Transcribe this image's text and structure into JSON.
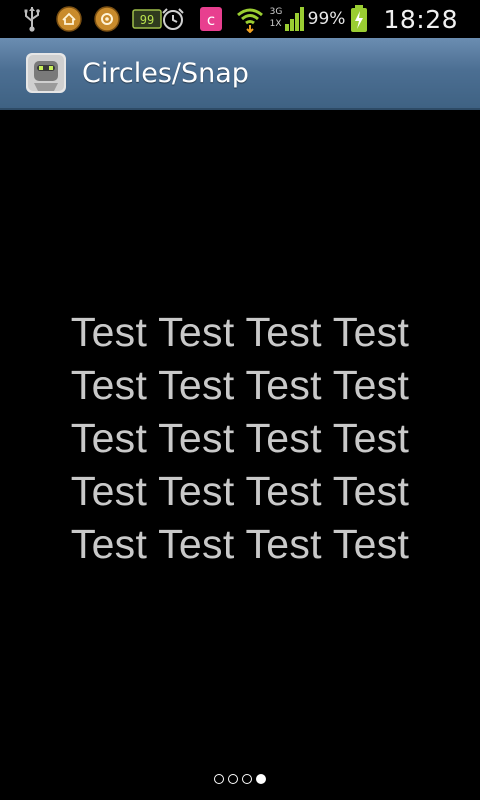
{
  "status_bar": {
    "icons_left": [
      "usb-icon",
      "home-badge-icon",
      "settings-badge-icon",
      "battery-meter-icon"
    ],
    "icons_right": [
      "alarm-icon",
      "c-app-icon",
      "wifi-icon",
      "signal-icon",
      "battery-charging-icon"
    ],
    "network_type_top": "3G",
    "network_type_bottom": "1X",
    "battery_percent": "99%",
    "time": "18:28"
  },
  "action_bar": {
    "title": "Circles/Snap",
    "icon": "robot-app-icon",
    "gradient_top": "#6b8db1",
    "gradient_bottom": "#3f6283"
  },
  "content": {
    "lines": [
      "Test Test Test Test",
      "Test Test Test Test",
      "Test Test Test Test",
      "Test Test Test Test",
      "Test Test Test Test"
    ],
    "text_color": "#c9c9c9"
  },
  "page_indicator": {
    "total": 4,
    "current": 4
  }
}
